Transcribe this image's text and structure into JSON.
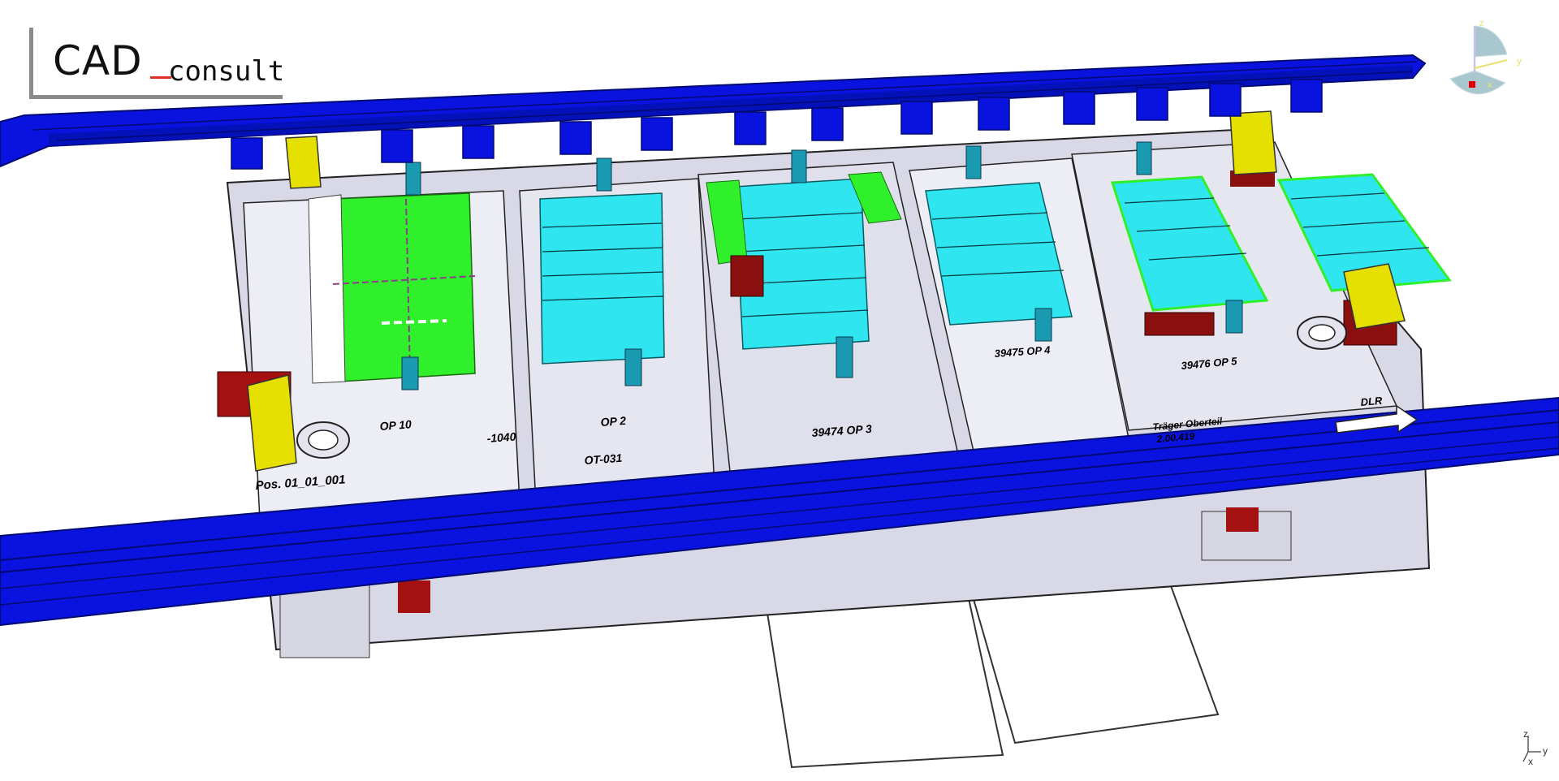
{
  "logo": {
    "main": "CAD",
    "sub": "consult",
    "accent_color": "#e03020"
  },
  "compass": {
    "axis_z": "z",
    "axis_y": "y",
    "axis_x": "x"
  },
  "mini_axis": {
    "axis_z": "z",
    "axis_y": "y",
    "axis_x": "x"
  },
  "model_labels": {
    "pos_label": "Pos. 01_01_001",
    "op_10": "OP 10",
    "part_1040": "-1040",
    "op_2": "OP 2",
    "ot_label": "OT-031",
    "op_3": "39474 OP 3",
    "op_4": "39475 OP 4",
    "op_5": "39476 OP 5",
    "oberteil": "Träger Oberteil",
    "oberteil_num": "2.00.419",
    "dlr_arrow": "DLR"
  },
  "colors": {
    "rail_blue": "#0a12e0",
    "rail_dark": "#000a70",
    "frame": "#c9c9da",
    "green_part": "#2ff02a",
    "cyan_part": "#2fe6f0",
    "yellow_block": "#e6e000",
    "dark_red": "#8a1010"
  }
}
